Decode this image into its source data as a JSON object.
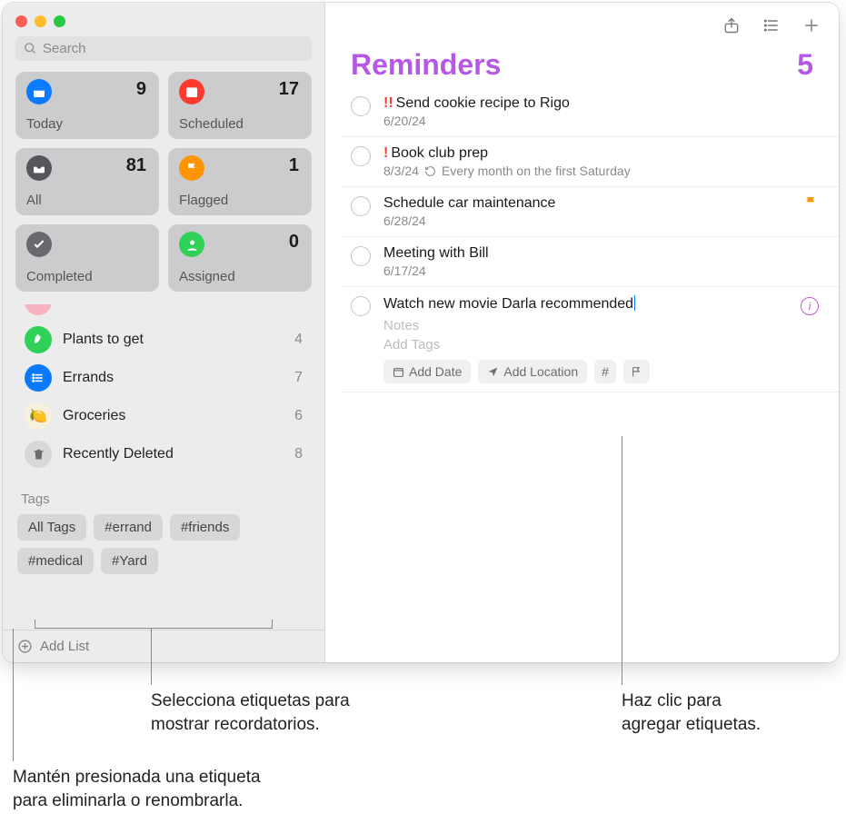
{
  "sidebar": {
    "search_placeholder": "Search",
    "smart": [
      {
        "label": "Today",
        "count": "9"
      },
      {
        "label": "Scheduled",
        "count": "17"
      },
      {
        "label": "All",
        "count": "81"
      },
      {
        "label": "Flagged",
        "count": "1"
      },
      {
        "label": "Completed",
        "count": ""
      },
      {
        "label": "Assigned",
        "count": "0"
      }
    ],
    "lists": [
      {
        "label": "Plants to get",
        "count": "4",
        "color": "#30d158"
      },
      {
        "label": "Errands",
        "count": "7",
        "color": "#0a7aff"
      },
      {
        "label": "Groceries",
        "count": "6",
        "color": "#f0e9d2"
      },
      {
        "label": "Recently Deleted",
        "count": "8",
        "color": "#9a9a9e"
      }
    ],
    "tags_header": "Tags",
    "tags": [
      "All Tags",
      "#errand",
      "#friends",
      "#medical",
      "#Yard"
    ],
    "add_list": "Add List"
  },
  "main": {
    "title": "Reminders",
    "count": "5",
    "items": [
      {
        "priority": "!!",
        "title": "Send cookie recipe to Rigo",
        "meta": "6/20/24",
        "flag": false
      },
      {
        "priority": "!",
        "title": "Book club prep",
        "meta": "8/3/24",
        "repeat": "Every month on the first Saturday",
        "flag": false
      },
      {
        "priority": "",
        "title": "Schedule car maintenance",
        "meta": "6/28/24",
        "flag": true
      },
      {
        "priority": "",
        "title": "Meeting with Bill",
        "meta": "6/17/24",
        "flag": false
      }
    ],
    "active": {
      "title": "Watch new movie Darla recommended",
      "notes_ph": "Notes",
      "tags_ph": "Add Tags",
      "chip_date": "Add Date",
      "chip_loc": "Add Location"
    }
  },
  "callouts": {
    "c1": "Selecciona etiquetas para\nmostrar recordatorios.",
    "c2": "Haz clic para\nagregar etiquetas.",
    "c3": "Mantén presionada una etiqueta\npara eliminarla o renombrarla."
  }
}
